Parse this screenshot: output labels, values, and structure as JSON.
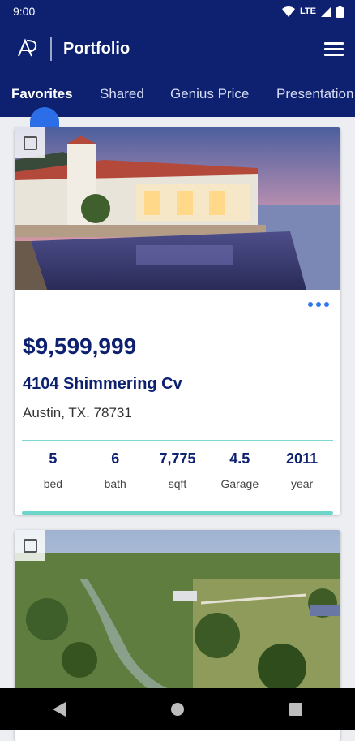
{
  "status_bar": {
    "time": "9:00",
    "network": "LTE"
  },
  "app_bar": {
    "title": "Portfolio",
    "logo_icon": "ap-logo-icon",
    "menu_icon": "hamburger-menu-icon"
  },
  "tabs": [
    {
      "label": "Favorites",
      "active": true
    },
    {
      "label": "Shared",
      "active": false
    },
    {
      "label": "Genius Price",
      "active": false
    },
    {
      "label": "Presentation",
      "active": false
    }
  ],
  "listings": [
    {
      "price": "$9,599,999",
      "address": "4104 Shimmering Cv",
      "city": "Austin, TX. 78731",
      "stats": [
        {
          "value": "5",
          "label": "bed"
        },
        {
          "value": "6",
          "label": "bath"
        },
        {
          "value": "7,775",
          "label": "sqft"
        },
        {
          "value": "4.5",
          "label": "Garage"
        },
        {
          "value": "2011",
          "label": "year"
        }
      ]
    }
  ],
  "colors": {
    "brand": "#0d2170",
    "accent": "#2f78e8",
    "teal": "#6ed6c8"
  },
  "nav": {
    "back_icon": "back-triangle-icon",
    "home_icon": "home-circle-icon",
    "recents_icon": "recents-square-icon"
  }
}
